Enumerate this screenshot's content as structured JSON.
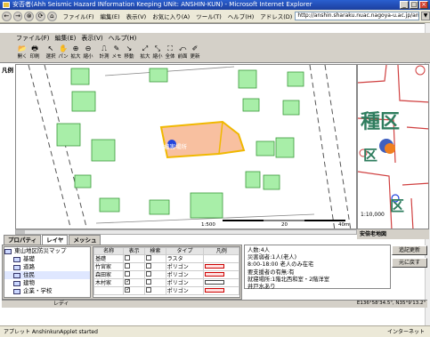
{
  "window": {
    "title": "安否者(Ahh Seismic Hazard INformation Keeping UNit: ANSHIN-KUN) - Microsoft Internet Explorer",
    "controls": {
      "minimize": "_",
      "maximize": "□",
      "close": "×"
    }
  },
  "browser": {
    "back": "←",
    "forward": "→",
    "stop": "⊗",
    "refresh": "⟳",
    "home": "⌂",
    "menus": [
      "ファイル(F)",
      "編集(E)",
      "表示(V)",
      "お気に入り(A)",
      "ツール(T)",
      "ヘルプ(H)"
    ],
    "address_label": "アドレス(D)",
    "address_value": "http://anshin.sharaku.nuac.nagoya-u.ac.jp/anshin/AnshinkunApplet.ht",
    "go": "▼"
  },
  "app": {
    "menus": [
      "ファイル(F)",
      "編集(E)",
      "表示(V)",
      "ヘルプ(H)"
    ],
    "toolbar": [
      {
        "icon": "open-icon",
        "glyph": "📂",
        "label": "開く"
      },
      {
        "icon": "print-icon",
        "glyph": "🖶",
        "label": "印刷"
      },
      {
        "icon": "select-icon",
        "glyph": "↖",
        "label": "選択"
      },
      {
        "icon": "pan-icon",
        "glyph": "✋",
        "label": "パン"
      },
      {
        "icon": "zoom-in-icon",
        "glyph": "⊕",
        "label": "拡大"
      },
      {
        "icon": "zoom-out-icon",
        "glyph": "⊖",
        "label": "縮小"
      },
      {
        "icon": "measure-icon",
        "glyph": "⎍",
        "label": "計測"
      },
      {
        "icon": "memo-icon",
        "glyph": "✎",
        "label": "メモ"
      },
      {
        "icon": "move-icon",
        "glyph": "↘",
        "label": "移動"
      },
      {
        "icon": "expand-icon",
        "glyph": "⤢",
        "label": "拡大"
      },
      {
        "icon": "shrink-icon",
        "glyph": "⤡",
        "label": "縮小"
      },
      {
        "icon": "full-view-icon",
        "glyph": "⛶",
        "label": "全体"
      },
      {
        "icon": "previous-view-icon",
        "glyph": "⤺",
        "label": "前面"
      },
      {
        "icon": "edit-icon",
        "glyph": "✐",
        "label": "更新"
      }
    ],
    "legend_label": "凡例"
  },
  "map": {
    "disaster_label": "被害場所",
    "scale": {
      "left": "1:500",
      "mid": "20",
      "right": "40m"
    },
    "colors": {
      "building": "#a8eea8",
      "building_stroke": "#3a9a3a",
      "highlight_fill": "#f8c0a0",
      "highlight_stroke": "#f0b800",
      "marker": "#2244dd"
    }
  },
  "minimap": {
    "label_ward": "種区",
    "label_ku": "区",
    "label_ku2": "区",
    "scale": "1:10,000",
    "banner": "安倍老地図"
  },
  "tabs": [
    "プロパティ",
    "レイヤ",
    "メッシュ"
  ],
  "tree": {
    "root": "東山地区防災マップ",
    "items": [
      "基礎",
      "道路",
      "住民",
      "建物",
      "企業・学校"
    ]
  },
  "layer_table": {
    "headers": [
      "名称",
      "表示",
      "検索",
      "タイプ",
      "凡例"
    ],
    "rows": [
      {
        "name": "基礎",
        "type": "ラスタ",
        "show": false,
        "search": false
      },
      {
        "name": "竹宮家",
        "type": "ポリゴン",
        "show": false,
        "search": false
      },
      {
        "name": "森田家",
        "type": "ポリゴン",
        "show": false,
        "search": false
      },
      {
        "name": "木村家",
        "type": "ポリゴン",
        "show": true,
        "search": false
      },
      {
        "name": "",
        "type": "ポリゴン",
        "show": true,
        "search": false
      }
    ]
  },
  "info": {
    "lines": [
      "人数:4人",
      "災害弱者:1人(老人)",
      "8:00-18:00 老人のみ在宅",
      "要支援者の有無:有",
      "就寝場所:1階北西和室・2階洋室",
      "井戸水あり"
    ],
    "buttons": [
      "追記更新",
      "元に戻す"
    ]
  },
  "status": {
    "left": "レディ",
    "right": "E136°58'34.5\", N35°9'13.2\""
  },
  "ie_status": {
    "text": "アプレット AnshinkunApplet started",
    "zone": "インターネット"
  }
}
